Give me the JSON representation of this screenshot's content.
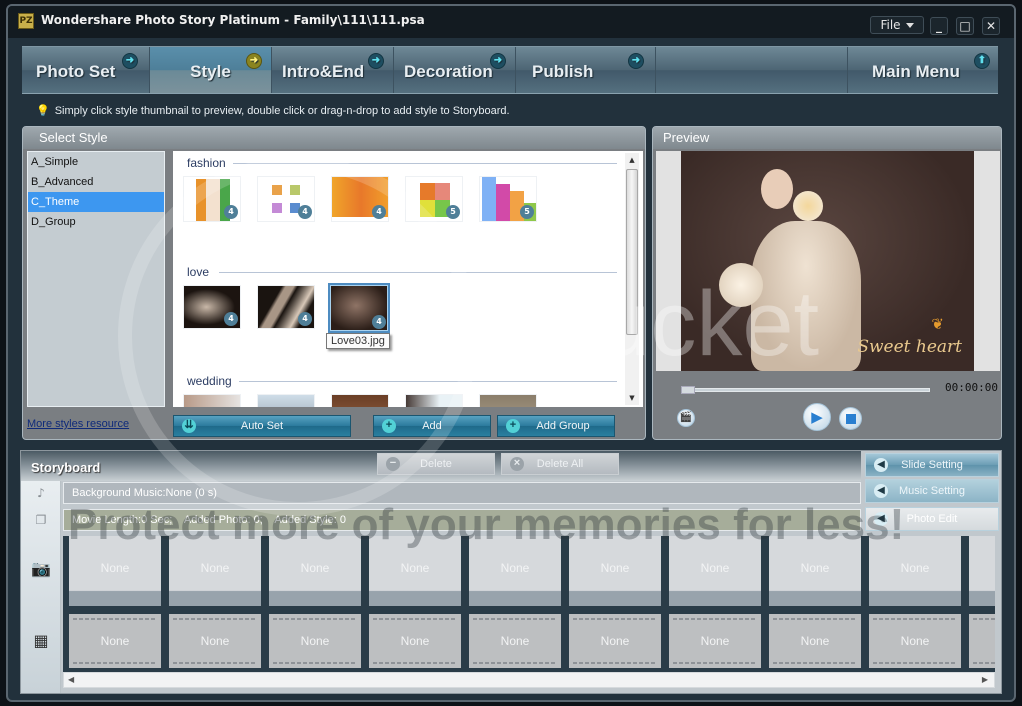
{
  "window": {
    "title": "Wondershare Photo Story Platinum - Family\\111\\111.psa",
    "app_icon": "photo-story-icon",
    "file_menu": "File",
    "controls": {
      "minimize": "_",
      "maximize": "□",
      "close": "✕"
    }
  },
  "nav": {
    "tabs": [
      {
        "label": "Photo Set",
        "icon": "arrow-right-icon",
        "active": false
      },
      {
        "label": "Style",
        "icon": "arrow-right-icon",
        "active": true
      },
      {
        "label": "Intro&End",
        "icon": "arrow-right-icon",
        "active": false
      },
      {
        "label": "Decoration",
        "icon": "arrow-right-icon",
        "active": false
      },
      {
        "label": "Publish",
        "icon": "arrow-right-icon",
        "active": false
      }
    ],
    "main_menu": {
      "label": "Main Menu",
      "icon": "arrow-up-icon"
    }
  },
  "hint": "Simply click style thumbnail to preview, double click or drag-n-drop to add style to Storyboard.",
  "select_style": {
    "title": "Select Style",
    "categories": [
      {
        "label": "A_Simple",
        "selected": false
      },
      {
        "label": "B_Advanced",
        "selected": false
      },
      {
        "label": "C_Theme",
        "selected": true
      },
      {
        "label": "D_Group",
        "selected": false
      }
    ],
    "groups": [
      {
        "name": "fashion",
        "thumbs": [
          {
            "badge": "4"
          },
          {
            "badge": "4"
          },
          {
            "badge": "4"
          },
          {
            "badge": "5"
          },
          {
            "badge": "5"
          }
        ]
      },
      {
        "name": "love",
        "thumbs": [
          {
            "badge": "4"
          },
          {
            "badge": "4"
          },
          {
            "badge": "4",
            "selected": true
          }
        ]
      },
      {
        "name": "wedding",
        "thumbs": [
          {},
          {},
          {},
          {},
          {}
        ]
      }
    ],
    "tooltip": "Love03.jpg",
    "more_link": "More styles resource",
    "buttons": {
      "auto_set": "Auto Set",
      "add": "Add",
      "add_group": "Add Group",
      "delete": "Delete",
      "delete_all": "Delete All"
    }
  },
  "preview": {
    "title": "Preview",
    "overlay_text": "Sweet heart",
    "time": "00:00:00",
    "progress": 0
  },
  "storyboard": {
    "title": "Storyboard",
    "background_music": "Background Music:None (0 s)",
    "movie_info": "Movie Length:0 Sec;    Added Photo: 0;    Added Style: 0",
    "side_buttons": {
      "slide_setting": "Slide Setting",
      "music_setting": "Music Setting",
      "photo_edit": "Photo Edit"
    },
    "photo_slots": [
      "None",
      "None",
      "None",
      "None",
      "None",
      "None",
      "None",
      "None",
      "None"
    ],
    "style_slots": [
      "None",
      "None",
      "None",
      "None",
      "None",
      "None",
      "None",
      "None",
      "None"
    ]
  },
  "watermark": {
    "line1": "Protect more of your memories for less!",
    "line2": "bucket"
  }
}
